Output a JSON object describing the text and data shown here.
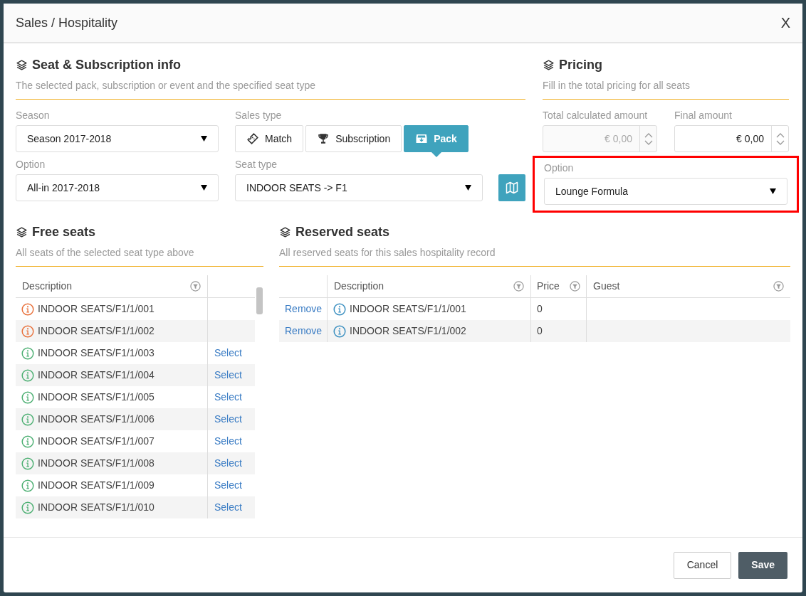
{
  "dialog": {
    "title": "Sales / Hospitality",
    "close": "X"
  },
  "seat_info": {
    "title": "Seat & Subscription info",
    "subtitle": "The selected pack, subscription or event and the specified seat type",
    "season": {
      "label": "Season",
      "value": "Season 2017-2018"
    },
    "sales_type": {
      "label": "Sales type",
      "options": [
        {
          "label": "Match",
          "kind": "ticket",
          "selected": false
        },
        {
          "label": "Subscription",
          "kind": "trophy",
          "selected": false
        },
        {
          "label": "Pack",
          "kind": "box",
          "selected": true
        }
      ]
    },
    "option": {
      "label": "Option",
      "value": "All-in 2017-2018"
    },
    "seat_type": {
      "label": "Seat type",
      "value": "INDOOR SEATS -> F1"
    }
  },
  "pricing": {
    "title": "Pricing",
    "subtitle": "Fill in the total pricing for all seats",
    "total": {
      "label": "Total calculated amount",
      "value": "€ 0,00",
      "disabled": true
    },
    "final": {
      "label": "Final amount",
      "value": "€ 0,00",
      "disabled": false
    },
    "option": {
      "label": "Option",
      "value": "Lounge Formula",
      "highlighted": true
    }
  },
  "free_seats": {
    "title": "Free seats",
    "subtitle": "All seats of the selected seat type above",
    "columns": [
      "Description"
    ],
    "rows": [
      {
        "description": "INDOOR SEATS/F1/1/001",
        "color": "#e8703a",
        "action": ""
      },
      {
        "description": "INDOOR SEATS/F1/1/002",
        "color": "#e8703a",
        "action": ""
      },
      {
        "description": "INDOOR SEATS/F1/1/003",
        "color": "#4caf72",
        "action": "Select"
      },
      {
        "description": "INDOOR SEATS/F1/1/004",
        "color": "#4caf72",
        "action": "Select"
      },
      {
        "description": "INDOOR SEATS/F1/1/005",
        "color": "#4caf72",
        "action": "Select"
      },
      {
        "description": "INDOOR SEATS/F1/1/006",
        "color": "#4caf72",
        "action": "Select"
      },
      {
        "description": "INDOOR SEATS/F1/1/007",
        "color": "#4caf72",
        "action": "Select"
      },
      {
        "description": "INDOOR SEATS/F1/1/008",
        "color": "#4caf72",
        "action": "Select"
      },
      {
        "description": "INDOOR SEATS/F1/1/009",
        "color": "#4caf72",
        "action": "Select"
      },
      {
        "description": "INDOOR SEATS/F1/1/010",
        "color": "#4caf72",
        "action": "Select"
      }
    ]
  },
  "reserved_seats": {
    "title": "Reserved seats",
    "subtitle": "All reserved seats for this sales hospitality record",
    "columns": [
      "Description",
      "Price",
      "Guest"
    ],
    "rows": [
      {
        "action": "Remove",
        "description": "INDOOR SEATS/F1/1/001",
        "color": "#3a8fc0",
        "price": "0"
      },
      {
        "action": "Remove",
        "description": "INDOOR SEATS/F1/1/002",
        "color": "#3a8fc0",
        "price": "0"
      }
    ]
  },
  "footer": {
    "cancel": "Cancel",
    "save": "Save"
  }
}
